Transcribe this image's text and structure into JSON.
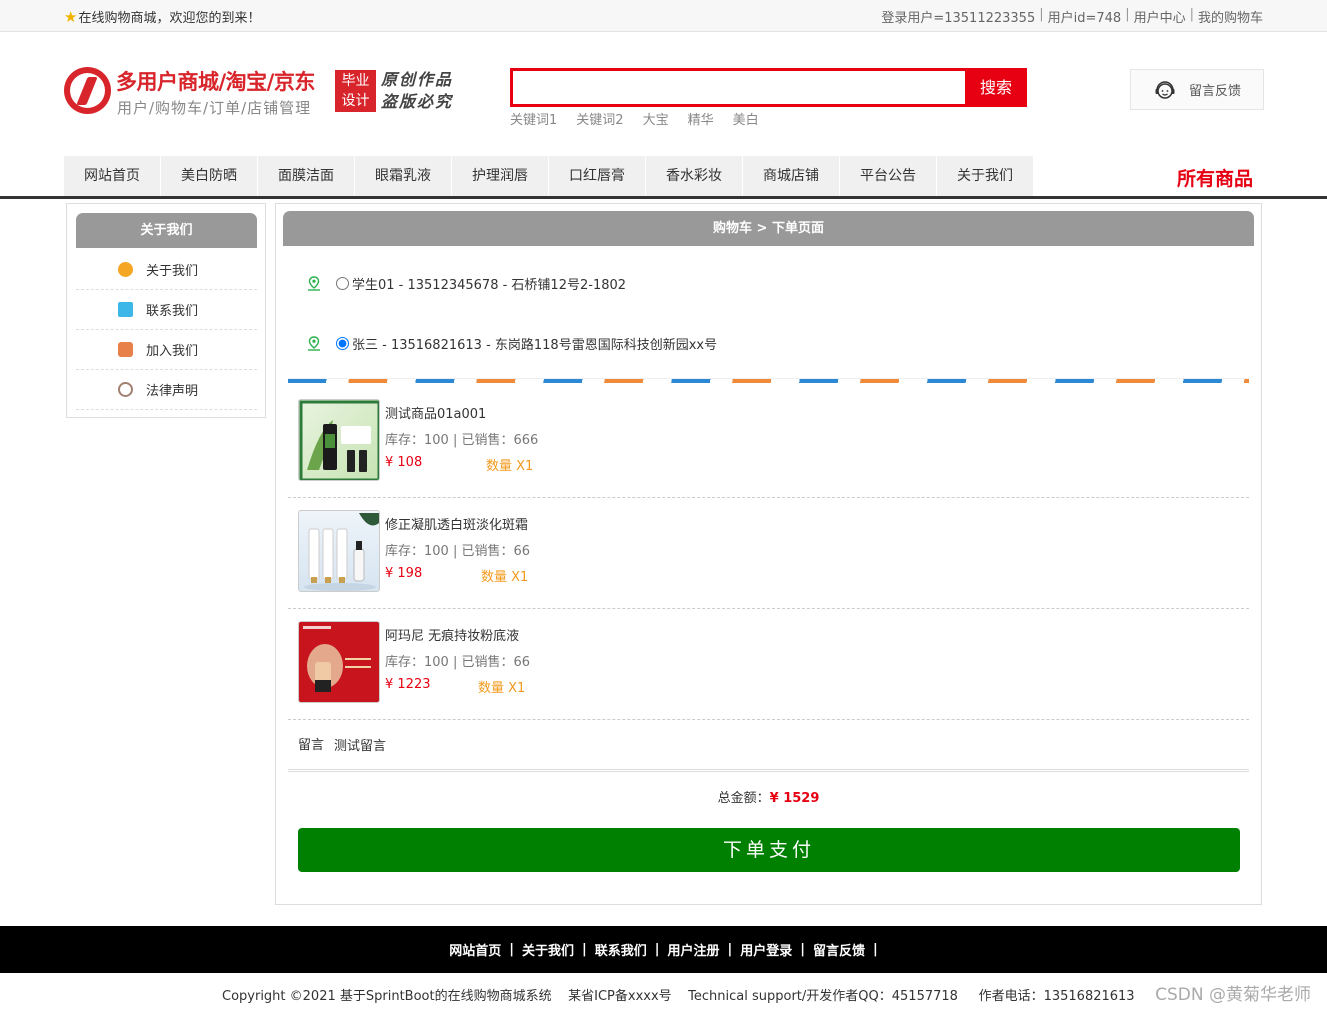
{
  "topbar": {
    "welcome": "在线购物商城，欢迎您的到来！",
    "links": [
      "登录用户=13511223355",
      "用户id=748",
      "用户中心",
      "我的购物车"
    ]
  },
  "header": {
    "title": "多用户商城/淘宝/京东",
    "subtitle": "用户/购物车/订单/店铺管理",
    "badge_line1": "毕业",
    "badge_line2": "设计",
    "slogan_line1": "原创作品",
    "slogan_line2": "盗版必究"
  },
  "search": {
    "placeholder": "",
    "button": "搜索",
    "hot_words": [
      "关键词1",
      "关键词2",
      "大宝",
      "精华",
      "美白"
    ]
  },
  "feedback": {
    "label": "留言反馈"
  },
  "nav": {
    "items": [
      "网站首页",
      "美白防晒",
      "面膜洁面",
      "眼霜乳液",
      "护理润唇",
      "口红唇膏",
      "香水彩妆",
      "商城店铺",
      "平台公告",
      "关于我们"
    ],
    "all_goods": "所有商品"
  },
  "sidebar": {
    "title": "关于我们",
    "items": [
      {
        "label": "关于我们",
        "icon": "info-icon",
        "color": "#f5a623"
      },
      {
        "label": "联系我们",
        "icon": "clipboard-icon",
        "color": "#3cb7e8"
      },
      {
        "label": "加入我们",
        "icon": "lock-icon",
        "color": "#e8804a"
      },
      {
        "label": "法律声明",
        "icon": "power-icon",
        "color": "#a08070"
      }
    ]
  },
  "order": {
    "breadcrumb": "购物车 > 下单页面",
    "addresses": [
      {
        "text": "学生01 - 13512345678 - 石桥铺12号2-1802",
        "selected": false
      },
      {
        "text": "张三 - 13516821613 - 东岗路118号雷恩国际科技创新园xx号",
        "selected": true
      }
    ],
    "goods": [
      {
        "name": "测试商品01a001",
        "meta": "库存：100 | 已销售：666",
        "price": "¥ 108",
        "qty": "数量 X1"
      },
      {
        "name": "修正凝肌透白斑淡化斑霜",
        "meta": "库存：100 | 已销售：66",
        "price": "¥ 198",
        "qty": "数量 X1"
      },
      {
        "name": "阿玛尼 无痕持妆粉底液",
        "meta": "库存：100 | 已销售：66",
        "price": "¥ 1223",
        "qty": "数量 X1"
      }
    ],
    "memo_label": "留言",
    "memo_value": "测试留言",
    "total_label": "总金额：",
    "total_value": "¥ 1529",
    "pay_button": "下单支付"
  },
  "footer": {
    "links": [
      "网站首页",
      "关于我们",
      "联系我们",
      "用户注册",
      "用户登录",
      "留言反馈"
    ],
    "copyright": "Copyright ©2021 基于SprintBoot的在线购物商城系统    某省ICP备xxxx号    Technical support/开发作者QQ：45157718     作者电话：13516821613",
    "watermark": "CSDN @黄菊华老师"
  },
  "colors": {
    "accent": "#e60012",
    "pay": "#008000",
    "price": "#e60012",
    "qty": "#f39a1e"
  }
}
